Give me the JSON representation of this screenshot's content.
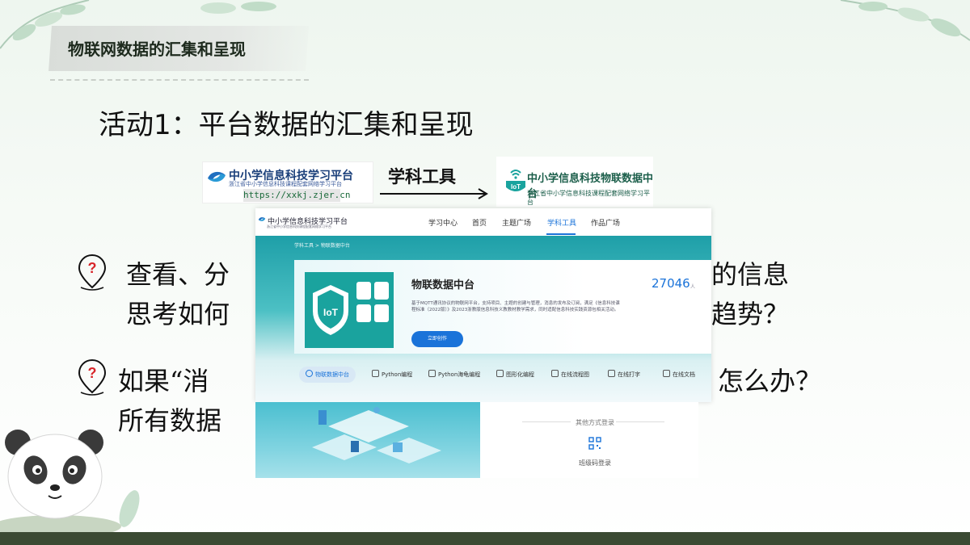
{
  "slide": {
    "section_title": "物联网数据的汇集和呈现",
    "activity_title": "活动1：平台数据的汇集和呈现"
  },
  "flow": {
    "left_logo": {
      "name": "中小学信息科技学习平台",
      "subtitle": "浙江省中小学信息科技课程配套网络学习平台",
      "url": "https://xxkj.zjer.cn"
    },
    "arrow_label": "学科工具",
    "right_logo": {
      "badge": "IoT",
      "name": "中小学信息科技物联数据中台",
      "subtitle": "浙江省中小学信息科技课程配套网络学习平台"
    }
  },
  "questions": [
    {
      "line1": "查看、分",
      "line1_tail": "的信息",
      "line2": "思考如何",
      "line2_tail": "趋势？"
    },
    {
      "line1": "如果“消",
      "line1_tail": "怎么办？",
      "line2": "所有数据"
    }
  ],
  "screenshot": {
    "logo": "中小学信息科技学习平台",
    "logo_sub": "浙江省中小学信息科技课程配套网络学习平台",
    "nav": [
      "学习中心",
      "首页",
      "主题广场",
      "学科工具",
      "作品广场"
    ],
    "nav_active": "学科工具",
    "breadcrumb": "学科工具 > 物联数据中台",
    "card_title": "物联数据中台",
    "count": "27046",
    "count_unit": "人",
    "description": "基于MQTT通讯协议的物联网平台，支持项目、主题的创建与管理，消息的发布及订阅，满足《信息科技课程标准（2022版）》及2023浙教版信息科技义教教材教学需求，同时适配信息科技实践资源包相关活动。",
    "cta": "立即创作",
    "tabs": [
      "物联数据中台",
      "Python编程",
      "Python海龟编程",
      "图形化编程",
      "在线流程图",
      "在线打字",
      "在线文档"
    ],
    "tab_active": "物联数据中台",
    "login_alt": "其他方式登录",
    "qr_label": "班级码登录"
  },
  "colors": {
    "accent_blue": "#1a73d9",
    "teal": "#1aa39e",
    "footer": "#3b4a33"
  }
}
